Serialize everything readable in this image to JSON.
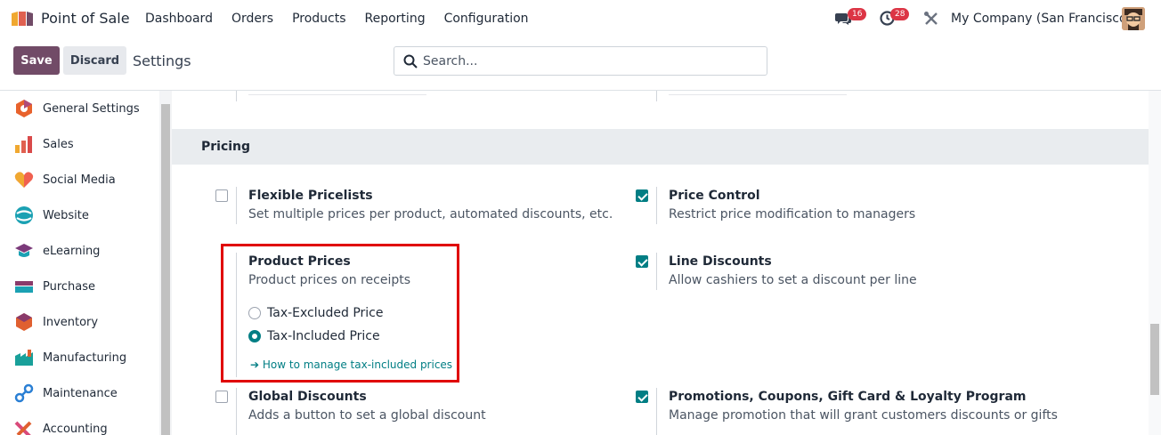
{
  "app": {
    "name": "Point of Sale",
    "menu": [
      "Dashboard",
      "Orders",
      "Products",
      "Reporting",
      "Configuration"
    ],
    "chat_count": "16",
    "activity_count": "28",
    "company": "My Company (San Francisco)"
  },
  "control_panel": {
    "save_label": "Save",
    "discard_label": "Discard",
    "title": "Settings",
    "search_placeholder": "Search..."
  },
  "sidebar": {
    "items": [
      {
        "label": "General Settings",
        "icon": "general-settings-icon",
        "color": "#e8622c"
      },
      {
        "label": "Sales",
        "icon": "sales-icon",
        "color": "#f0a830"
      },
      {
        "label": "Social Media",
        "icon": "social-media-icon",
        "color": "#f06050"
      },
      {
        "label": "Website",
        "icon": "website-icon",
        "color": "#1ba1b3"
      },
      {
        "label": "eLearning",
        "icon": "elearning-icon",
        "color": "#7b3a7a"
      },
      {
        "label": "Purchase",
        "icon": "purchase-icon",
        "color": "#8a3a6a"
      },
      {
        "label": "Inventory",
        "icon": "inventory-icon",
        "color": "#e06030"
      },
      {
        "label": "Manufacturing",
        "icon": "manufacturing-icon",
        "color": "#19a09a"
      },
      {
        "label": "Maintenance",
        "icon": "maintenance-icon",
        "color": "#2a7fd4"
      },
      {
        "label": "Accounting",
        "icon": "accounting-icon",
        "color": "#d94a7a"
      }
    ]
  },
  "pricing": {
    "section_title": "Pricing",
    "flexible_pricelists": {
      "title": "Flexible Pricelists",
      "desc": "Set multiple prices per product, automated discounts, etc.",
      "checked": false
    },
    "price_control": {
      "title": "Price Control",
      "desc": "Restrict price modification to managers",
      "checked": true
    },
    "product_prices": {
      "title": "Product Prices",
      "desc": "Product prices on receipts",
      "options": [
        {
          "label": "Tax-Excluded Price",
          "selected": false
        },
        {
          "label": "Tax-Included Price",
          "selected": true
        }
      ],
      "link": "➔ How to manage tax-included prices"
    },
    "line_discounts": {
      "title": "Line Discounts",
      "desc": "Allow cashiers to set a discount per line",
      "checked": true
    },
    "global_discounts": {
      "title": "Global Discounts",
      "desc": "Adds a button to set a global discount",
      "checked": false
    },
    "promotions": {
      "title": "Promotions, Coupons, Gift Card & Loyalty Program",
      "desc": "Manage promotion that will grant customers discounts or gifts",
      "checked": true
    }
  },
  "colors": {
    "brand": "#714b67",
    "accent": "#017e84",
    "highlight": "#e00000"
  }
}
